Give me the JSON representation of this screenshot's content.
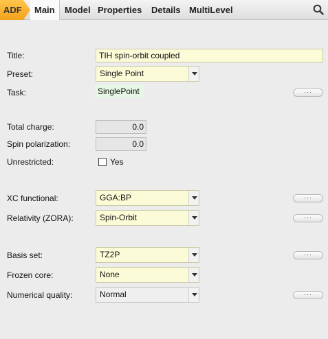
{
  "tabs": {
    "app_badge": "ADF",
    "items": [
      "Main",
      "Model",
      "Properties",
      "Details",
      "MultiLevel"
    ],
    "active": "Main",
    "search_icon": "search-icon"
  },
  "form": {
    "title": {
      "label": "Title:",
      "value": "TIH spin-orbit coupled"
    },
    "preset": {
      "label": "Preset:",
      "value": "Single Point"
    },
    "task": {
      "label": "Task:",
      "value": "SinglePoint",
      "more": "···"
    },
    "total_charge": {
      "label": "Total charge:",
      "value": "0.0"
    },
    "spin_polarization": {
      "label": "Spin polarization:",
      "value": "0.0"
    },
    "unrestricted": {
      "label": "Unrestricted:",
      "option": "Yes",
      "checked": false
    },
    "xc_functional": {
      "label": "XC functional:",
      "value": "GGA:BP",
      "more": "···"
    },
    "relativity": {
      "label": "Relativity (ZORA):",
      "value": "Spin-Orbit",
      "more": "···"
    },
    "basis_set": {
      "label": "Basis set:",
      "value": "TZ2P",
      "more": "···"
    },
    "frozen_core": {
      "label": "Frozen core:",
      "value": "None"
    },
    "numerical_quality": {
      "label": "Numerical quality:",
      "value": "Normal",
      "more": "···"
    }
  },
  "colors": {
    "adf_badge": "#f3a21c",
    "field_background": "#fbfbd7",
    "task_background": "#e6f7e6"
  }
}
